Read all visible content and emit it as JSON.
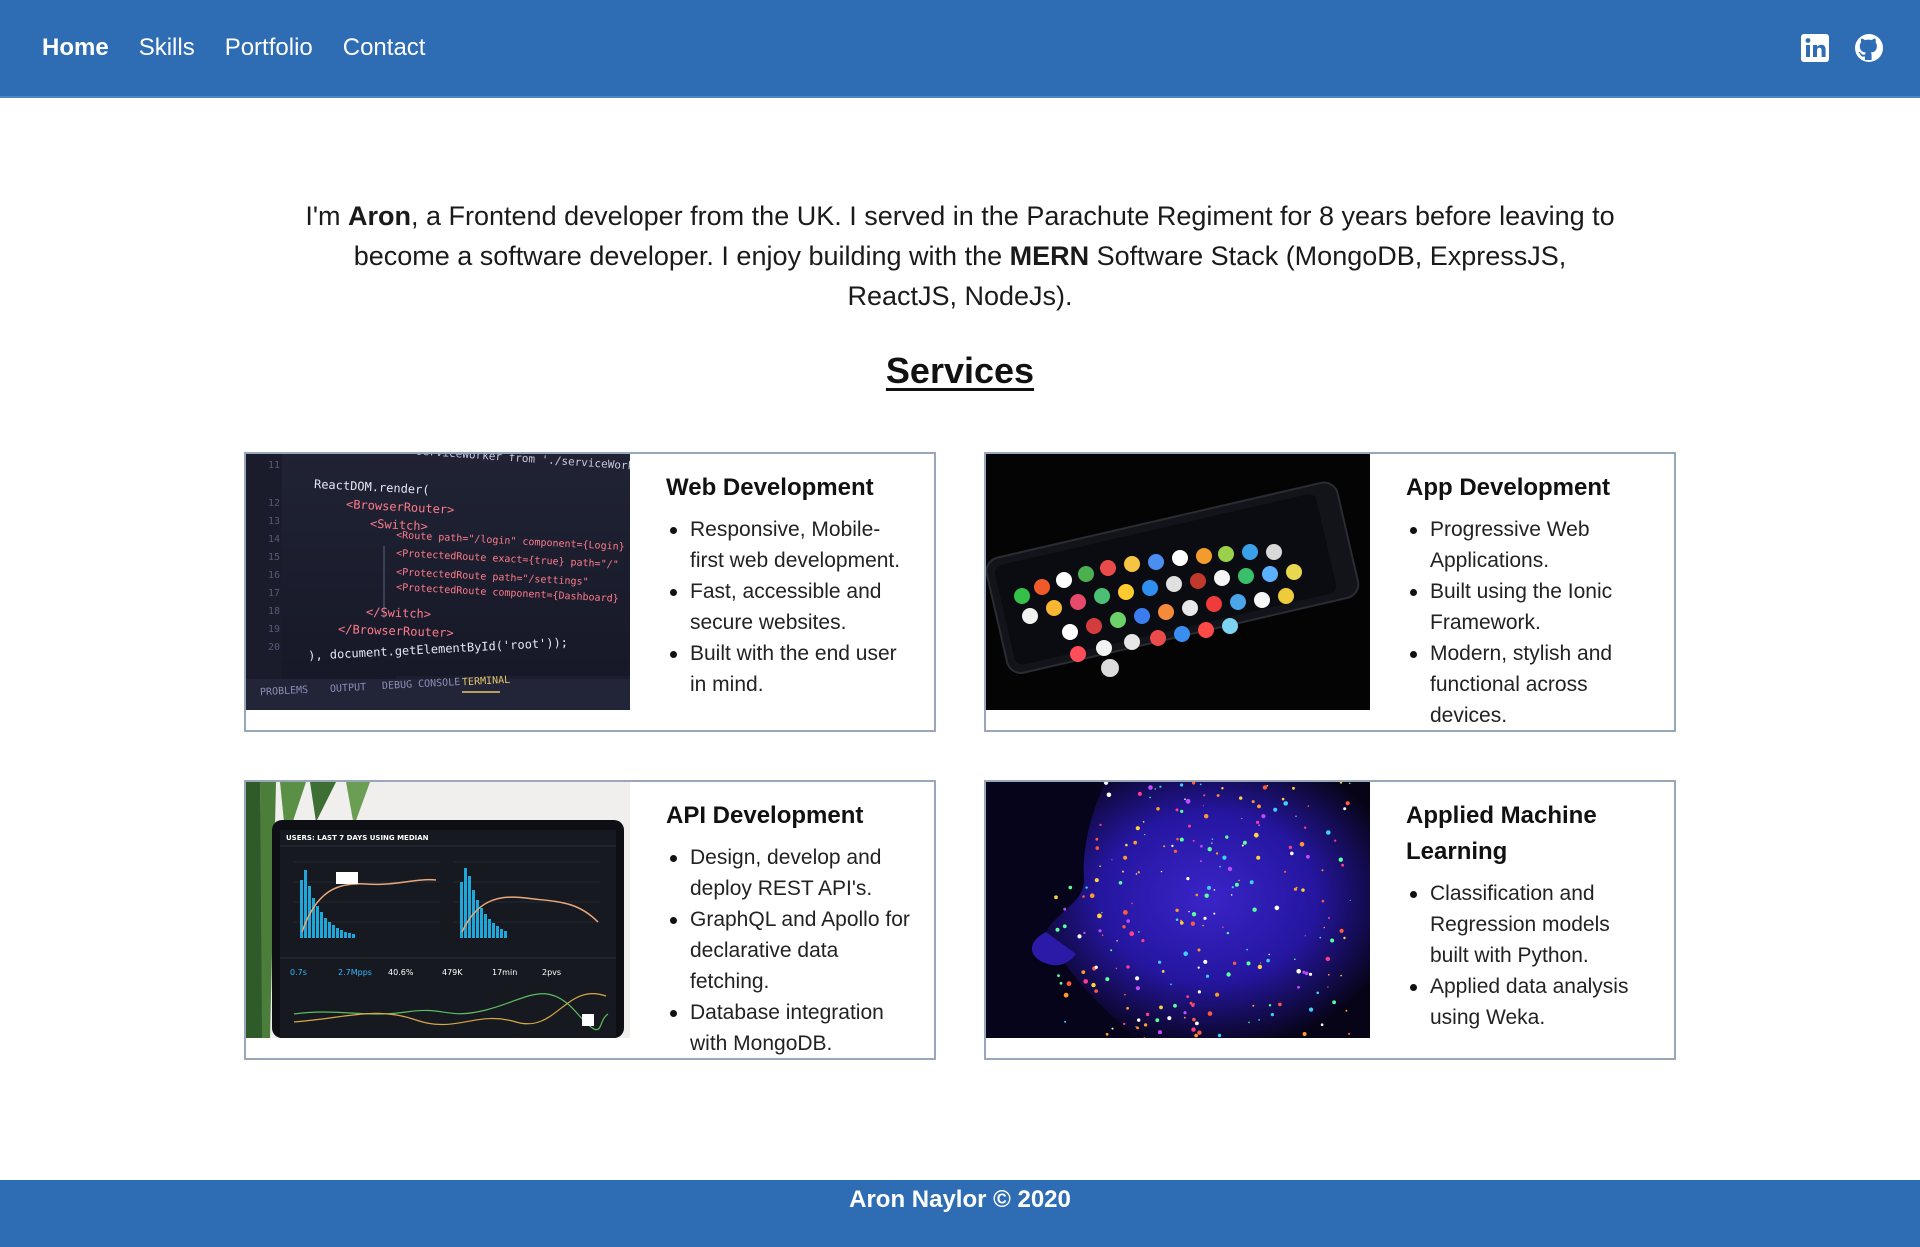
{
  "nav": {
    "links": [
      "Home",
      "Skills",
      "Portfolio",
      "Contact"
    ],
    "active": "Home",
    "icons": [
      "linkedin-icon",
      "github-icon"
    ]
  },
  "intro": {
    "part1": "I'm ",
    "name": "Aron",
    "part2": ", a Frontend developer from the UK. I served in the Parachute Regiment for 8 years before leaving to become a software developer. I enjoy building with the ",
    "stack": "MERN",
    "part3": " Software Stack (MongoDB, ExpressJS, ReactJS, NodeJs)."
  },
  "services_title": "Services",
  "cards": [
    {
      "title": "Web Development",
      "items": [
        "Responsive, Mobile-first web development.",
        "Fast, accessible and secure websites.",
        "Built with the end user in mind."
      ]
    },
    {
      "title": "App Development",
      "items": [
        "Progressive Web Applications.",
        "Built using the Ionic Framework.",
        "Modern, stylish and functional across devices."
      ]
    },
    {
      "title": "API Development",
      "items": [
        "Design, develop and deploy REST API's.",
        "GraphQL and Apollo for declarative data fetching.",
        "Database integration with MongoDB."
      ]
    },
    {
      "title": "Applied Machine Learning",
      "items": [
        "Classification and Regression models built with Python.",
        "Applied data analysis using Weka."
      ]
    }
  ],
  "code_image": {
    "lines": [
      "as serviceWorker from './serviceWorker'",
      "ReactDOM.render(",
      "<BrowserRouter>",
      "<Switch>",
      "<Route path=\"/login\" component={Login}",
      "<ProtectedRoute exact={true} path=\"/\"",
      "<ProtectedRoute path=\"/settings\"",
      "<ProtectedRoute component={Dashboard}",
      "</Switch>",
      "</BrowserRouter>",
      "), document.getElementById('root'));"
    ],
    "tabs": [
      "PROBLEMS",
      "OUTPUT",
      "DEBUG CONSOLE",
      "TERMINAL"
    ]
  },
  "dash_image": {
    "header": "USERS: LAST 7 DAYS USING MEDIAN",
    "stats": [
      "0.7s",
      "2.7Mpps",
      "40.6%",
      "479K",
      "17min",
      "2pvs"
    ]
  },
  "footer": "Aron Naylor © 2020"
}
